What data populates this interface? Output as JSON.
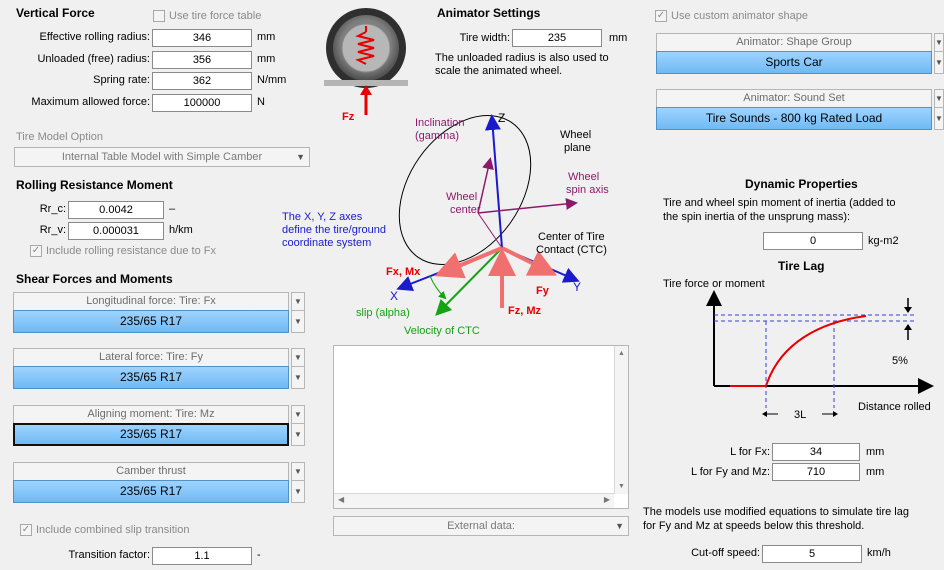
{
  "vertical_force": {
    "title": "Vertical Force",
    "use_table_label": "Use tire force table",
    "rows": [
      {
        "label": "Effective rolling radius:",
        "value": "346",
        "unit": "mm"
      },
      {
        "label": "Unloaded (free) radius:",
        "value": "356",
        "unit": "mm"
      },
      {
        "label": "Spring rate:",
        "value": "362",
        "unit": "N/mm"
      },
      {
        "label": "Maximum allowed force:",
        "value": "100000",
        "unit": "N"
      }
    ]
  },
  "tire_model": {
    "label": "Tire Model Option",
    "value": "Internal Table Model with Simple Camber"
  },
  "rolling_resistance": {
    "title": "Rolling Resistance Moment",
    "rrc_label": "Rr_c:",
    "rrc_value": "0.0042",
    "rrc_unit": "–",
    "rrv_label": "Rr_v:",
    "rrv_value": "0.000031",
    "rrv_unit": "h/km",
    "include_label": "Include rolling resistance due to Fx"
  },
  "shear": {
    "title": "Shear Forces and Moments",
    "dropdowns": [
      {
        "label": "Longitudinal force: Tire: Fx",
        "value": "235/65 R17"
      },
      {
        "label": "Lateral force: Tire: Fy",
        "value": "235/65 R17"
      },
      {
        "label": "Aligning moment: Tire: Mz",
        "value": "235/65 R17"
      },
      {
        "label": "Camber thrust",
        "value": "235/65 R17"
      }
    ],
    "combined_label": "Include combined slip transition",
    "transition_label": "Transition factor:",
    "transition_value": "1.1",
    "transition_unit": "-"
  },
  "animator": {
    "title": "Animator Settings",
    "width_label": "Tire width:",
    "width_value": "235",
    "width_unit": "mm",
    "note": "The unloaded radius is also used to scale the animated wheel.",
    "fz_label": "Fz",
    "custom_shape_label": "Use custom animator shape",
    "shape_group_label": "Animator: Shape Group",
    "shape_group_value": "Sports Car",
    "sound_set_label": "Animator: Sound Set",
    "sound_set_value": "Tire Sounds - 800 kg Rated Load"
  },
  "diagram": {
    "z": "Z",
    "inclination": "Inclination",
    "gamma": "(gamma)",
    "wheel": "Wheel",
    "plane": "plane",
    "spin1": "Wheel",
    "spin2": "spin axis",
    "center1": "Wheel",
    "center2": "center",
    "axes1": "The X, Y, Z axes",
    "axes2": "define the tire/ground",
    "axes3": "coordinate system",
    "ctc1": "Center of Tire",
    "ctc2": "Contact (CTC)",
    "fxmx": "Fx, Mx",
    "fy": "Fy",
    "y": "Y",
    "x": "X",
    "slip": "slip (alpha)",
    "fzmz": "Fz, Mz",
    "velocity": "Velocity of CTC"
  },
  "external": {
    "label": "External data:"
  },
  "dynamic": {
    "title": "Dynamic Properties",
    "desc1": "Tire and wheel spin moment of inertia (added to",
    "desc2": "the spin inertia of the unsprung mass):",
    "inertia_value": "0",
    "inertia_unit": "kg-m2"
  },
  "tire_lag": {
    "title": "Tire Lag",
    "ylabel": "Tire force or moment",
    "xlabel": "Distance rolled",
    "pct": "5%",
    "length": "3L",
    "lfx_label": "L for Fx:",
    "lfx_value": "34",
    "lfx_unit": "mm",
    "lfy_label": "L for Fy and Mz:",
    "lfy_value": "710",
    "lfy_unit": "mm",
    "note1": "The models use modified equations to simulate tire lag",
    "note2": "for Fy and Mz at  speeds below this threshold.",
    "cutoff_label": "Cut-off speed:",
    "cutoff_value": "5",
    "cutoff_unit": "km/h"
  },
  "colors": {
    "accent_blue": "#6fbaf4",
    "force_red": "#e60000",
    "axis_blue": "#1a1acc",
    "purple": "#8b1a6b",
    "green": "#13a313"
  }
}
